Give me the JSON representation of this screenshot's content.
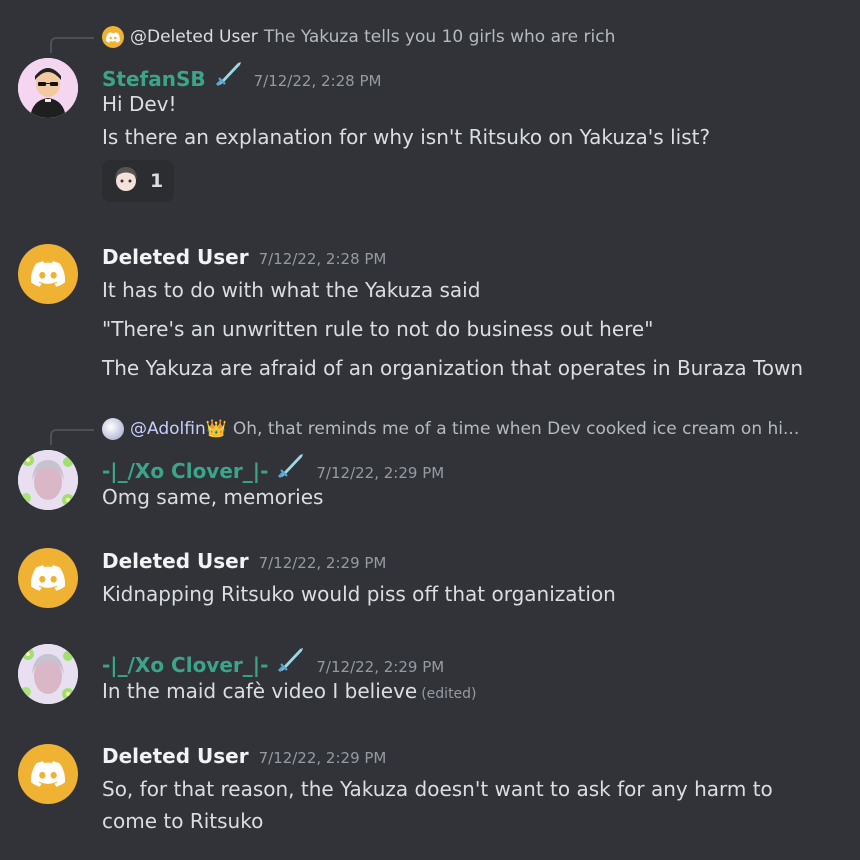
{
  "messages": [
    {
      "reply": {
        "author": "@Deleted User",
        "text": "The Yakuza tells you 10 girls who are rich"
      },
      "author": "StefanSB",
      "timestamp": "7/12/22, 2:28 PM",
      "lines": [
        "Hi Dev!",
        "Is there an explanation for why isn't Ritsuko on Yakuza's list?"
      ],
      "reaction": {
        "count": "1"
      }
    },
    {
      "author": "Deleted User",
      "timestamp": "7/12/22, 2:28 PM",
      "lines": [
        "It has to do with what the Yakuza said",
        "\"There's an unwritten rule to not do business out here\"",
        "The Yakuza are afraid of an organization that operates in Buraza Town"
      ]
    },
    {
      "reply": {
        "author": "@Adolfin👑",
        "text": "Oh, that reminds me of a time when Dev cooked ice cream on hi..."
      },
      "author": "-|_/Xo Clover_|-",
      "timestamp": "7/12/22, 2:29 PM",
      "lines": [
        "Omg same, memories"
      ]
    },
    {
      "author": "Deleted User",
      "timestamp": "7/12/22, 2:29 PM",
      "lines": [
        "Kidnapping Ritsuko would piss off that organization"
      ]
    },
    {
      "author": "-|_/Xo Clover_|-",
      "timestamp": "7/12/22, 2:29 PM",
      "lines": [
        "In the maid cafè video I believe"
      ],
      "edited": "(edited)"
    },
    {
      "author": "Deleted User",
      "timestamp": "7/12/22, 2:29 PM",
      "lines": [
        "So, for that reason, the Yakuza doesn't want to ask for any harm to",
        "come to Ritsuko"
      ]
    }
  ]
}
